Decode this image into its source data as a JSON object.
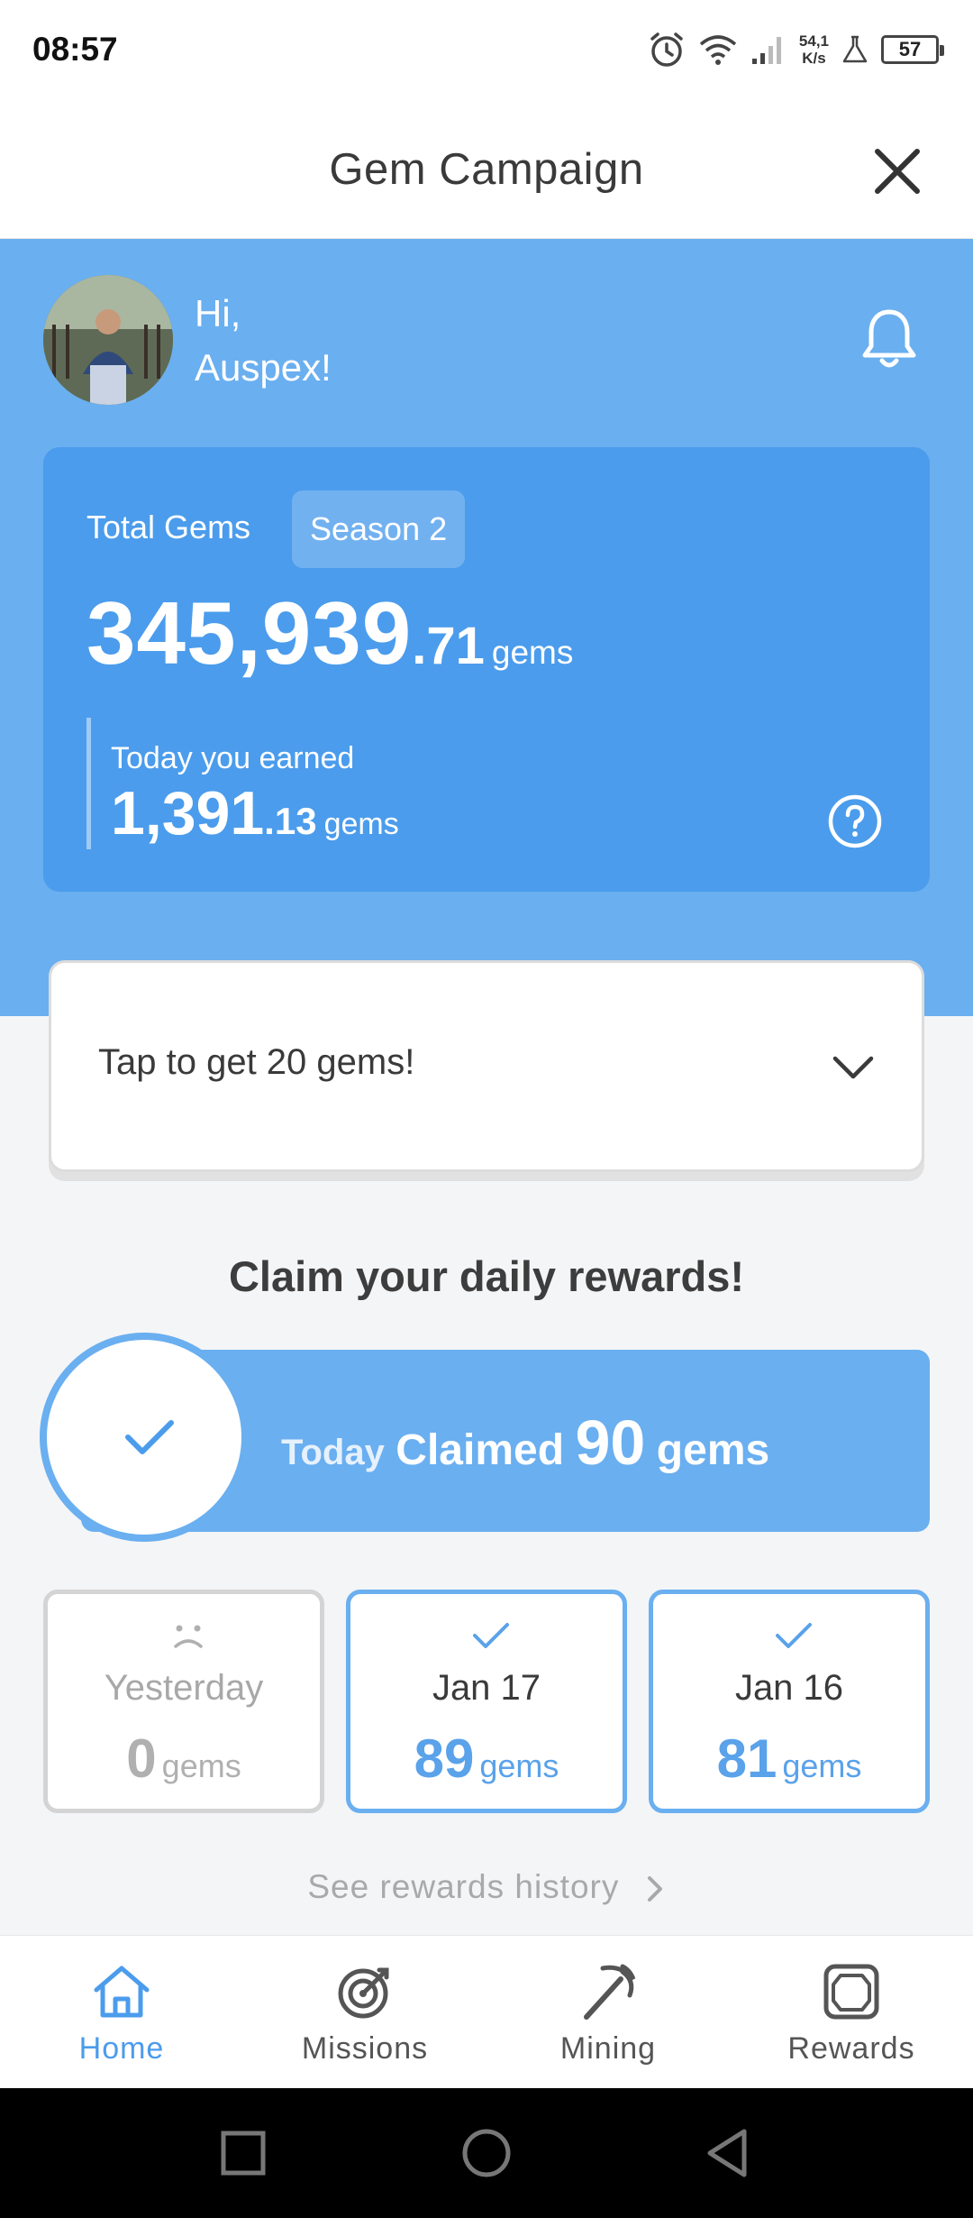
{
  "status_bar": {
    "time": "08:57",
    "net_speed_value": "54,1",
    "net_speed_unit": "K/s",
    "battery": "57"
  },
  "header": {
    "title": "Gem Campaign"
  },
  "profile": {
    "greeting_line1": "Hi,",
    "greeting_line2": "Auspex!"
  },
  "gems": {
    "label": "Total Gems",
    "season": "Season 2",
    "total_int": "345,939",
    "total_dec": ".71",
    "unit": "gems",
    "today_label": "Today you earned",
    "today_int": "1,391",
    "today_dec": ".13",
    "today_unit": "gems"
  },
  "tap": {
    "text": "Tap to get 20 gems!"
  },
  "daily": {
    "heading": "Claim your daily rewards!",
    "today_word": "Today",
    "claimed_word": "Claimed",
    "claimed_amount": "90",
    "claimed_unit": "gems",
    "days": [
      {
        "label": "Yesterday",
        "amount": "0",
        "unit": "gems",
        "status": "missed"
      },
      {
        "label": "Jan 17",
        "amount": "89",
        "unit": "gems",
        "status": "claimed"
      },
      {
        "label": "Jan 16",
        "amount": "81",
        "unit": "gems",
        "status": "claimed"
      }
    ],
    "history_link": "See rewards history"
  },
  "nav": {
    "items": [
      {
        "label": "Home",
        "icon": "home-icon",
        "active": true
      },
      {
        "label": "Missions",
        "icon": "target-icon",
        "active": false
      },
      {
        "label": "Mining",
        "icon": "pickaxe-icon",
        "active": false
      },
      {
        "label": "Rewards",
        "icon": "gem-icon",
        "active": false
      }
    ]
  },
  "colors": {
    "primary_blue": "#4b9cec",
    "light_blue": "#6aaff0",
    "background": "#f4f5f7"
  }
}
